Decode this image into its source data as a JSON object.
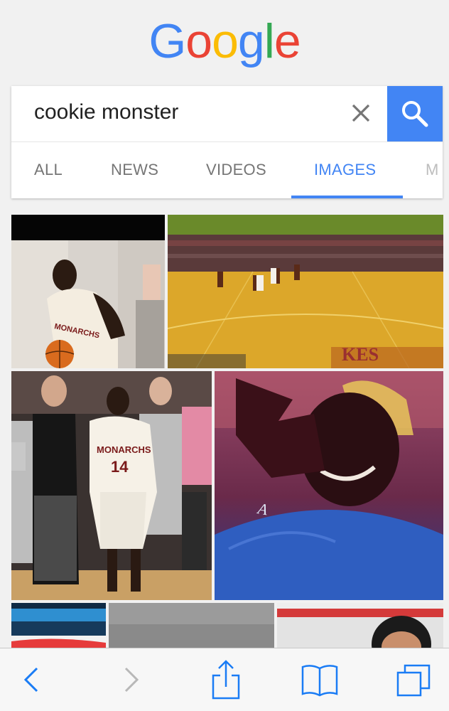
{
  "logo": {
    "letters": [
      "G",
      "o",
      "o",
      "g",
      "l",
      "e"
    ],
    "colors": [
      "#4285f4",
      "#ea4335",
      "#fbbc05",
      "#4285f4",
      "#34a853",
      "#ea4335"
    ]
  },
  "search": {
    "query": "cookie monster"
  },
  "tabs": [
    {
      "label": "ALL"
    },
    {
      "label": "NEWS"
    },
    {
      "label": "VIDEOS"
    },
    {
      "label": "IMAGES"
    },
    {
      "label": "M"
    }
  ],
  "accent_color": "#4285f4",
  "results": {
    "image_1": {
      "jersey": "MONARCHS"
    },
    "image_2": {
      "floor_text": "KES"
    },
    "image_3": {
      "jersey": "MONARCHS",
      "number": "14"
    },
    "image_4": {
      "shirt": "A"
    }
  },
  "toolbar": {
    "icons": [
      "back-icon",
      "forward-icon",
      "share-icon",
      "bookmarks-icon",
      "tabs-icon"
    ]
  }
}
